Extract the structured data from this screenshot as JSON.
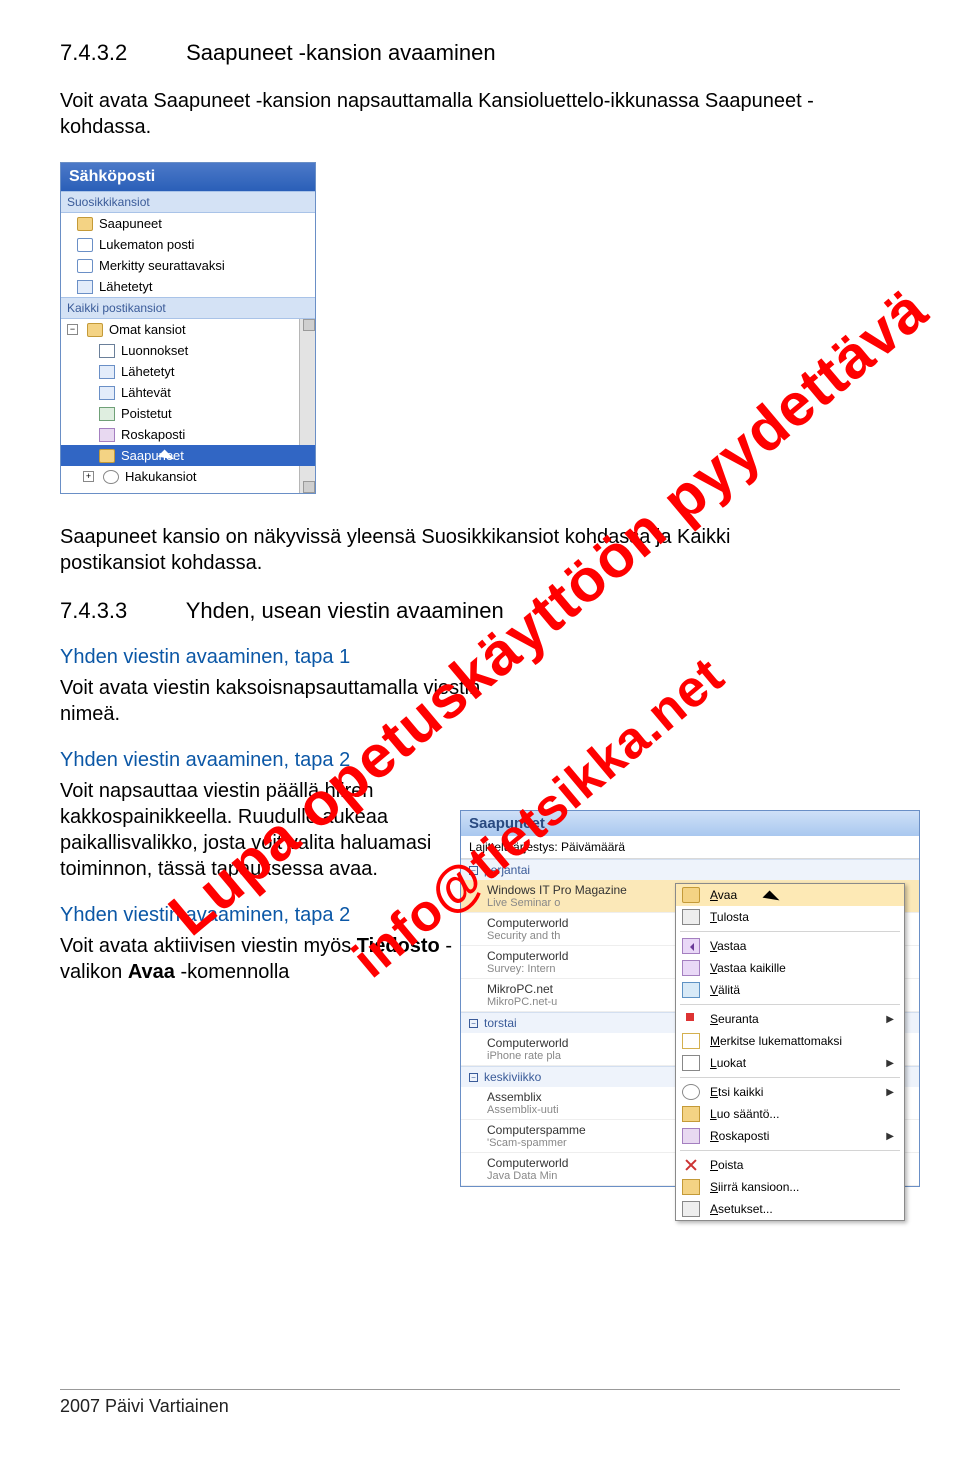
{
  "doc": {
    "section_742_num": "7.4.3.2",
    "section_742_title": "Saapuneet -kansion avaaminen",
    "intro742": "Voit avata Saapuneet -kansion napsauttamalla Kansioluettelo-ikkunassa Saapuneet -kohdassa.",
    "after_panel": "Saapuneet kansio on näkyvissä yleensä Suosikkikansiot kohdassa ja Kaikki postikansiot kohdassa.",
    "section_743_num": "7.4.3.3",
    "section_743_title": "Yhden, usean viestin avaaminen",
    "h1": "Yhden viestin avaaminen, tapa 1",
    "p1": "Voit avata viestin kaksoisnapsauttamalla viestin nimeä.",
    "h2": "Yhden viestin avaaminen, tapa 2",
    "p2": "Voit napsauttaa viestin päällä hiiren kakkospainikkeella. Ruudulle aukeaa paikallisvalikko, josta voit valita haluamasi toiminnon, tässä tapauksessa avaa.",
    "h3": "Yhden viestin avaaminen, tapa 2",
    "p3a": "Voit avata aktiivisen viestin myös ",
    "p3b": "Tiedosto",
    "p3c": " -valikon ",
    "p3d": "Avaa",
    "p3e": " -komennolla",
    "footer": "2007 Päivi Vartiainen"
  },
  "watermark": {
    "line1": "Lupa opetuskäyttöön pyydettävä",
    "line2": "info@tietsikka.net"
  },
  "sidebar": {
    "title": "Sähköposti",
    "fav_header": "Suosikkikansiot",
    "fav": [
      "Saapuneet",
      "Lukematon posti",
      "Merkitty seurattavaksi",
      "Lähetetyt"
    ],
    "all_header": "Kaikki postikansiot",
    "root": "Omat kansiot",
    "tree": [
      "Luonnokset",
      "Lähetetyt",
      "Lähtevät",
      "Poistetut",
      "Roskaposti",
      "Saapuneet",
      "Hakukansiot"
    ]
  },
  "inbox": {
    "title": "Saapuneet",
    "sort_label": "Lajittelujärjestys: Päivämäärä",
    "groups": [
      {
        "label": "perjantai",
        "msgs": [
          {
            "t1": "Windows IT Pro Magazine",
            "t2": "Live Seminar o",
            "sel": true
          },
          {
            "t1": "Computerworld",
            "t2": "Security and th"
          },
          {
            "t1": "Computerworld",
            "t2": "Survey: Intern"
          },
          {
            "t1": "MikroPC.net",
            "t2": "MikroPC.net-u"
          }
        ]
      },
      {
        "label": "torstai",
        "msgs": [
          {
            "t1": "Computerworld",
            "t2": "iPhone rate pla"
          }
        ]
      },
      {
        "label": "keskiviikko",
        "msgs": [
          {
            "t1": "Assemblix",
            "t2": "Assemblix-uuti"
          },
          {
            "t1": "Computerspamme",
            "t2": "'Scam-spammer"
          },
          {
            "t1": "Computerworld",
            "t2": "Java Data Min"
          }
        ]
      }
    ]
  },
  "context_menu": {
    "items": [
      {
        "label": "Avaa",
        "icon": "mi-open",
        "sel": true
      },
      {
        "label": "Tulosta",
        "icon": "mi-print"
      },
      {
        "sep": true
      },
      {
        "label": "Vastaa",
        "icon": "mi-reply"
      },
      {
        "label": "Vastaa kaikille",
        "icon": "mi-replyall"
      },
      {
        "label": "Välitä",
        "icon": "mi-fwd"
      },
      {
        "sep": true
      },
      {
        "label": "Seuranta",
        "icon": "mi-flag",
        "sub": true
      },
      {
        "label": "Merkitse lukemattomaksi",
        "icon": "mi-unread"
      },
      {
        "label": "Luokat",
        "icon": "mi-cat",
        "sub": true
      },
      {
        "sep": true
      },
      {
        "label": "Etsi kaikki",
        "icon": "mi-find",
        "sub": true
      },
      {
        "label": "Luo sääntö...",
        "icon": "mi-rule"
      },
      {
        "label": "Roskaposti",
        "icon": "mi-junk",
        "sub": true
      },
      {
        "sep": true
      },
      {
        "label": "Poista",
        "icon": "mi-del"
      },
      {
        "label": "Siirrä kansioon...",
        "icon": "mi-move"
      },
      {
        "label": "Asetukset...",
        "icon": "mi-opts"
      }
    ]
  }
}
